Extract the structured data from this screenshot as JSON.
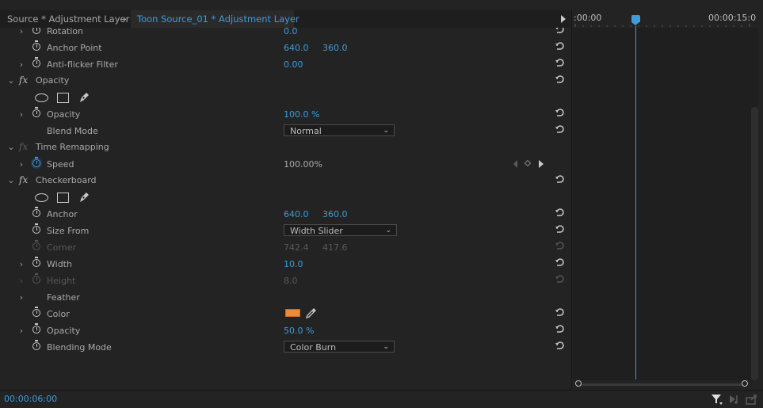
{
  "tabs": {
    "source": "Source * Adjustment Layer",
    "active": "Toon Source_01 * Adjustment Layer"
  },
  "timeline": {
    "ruler_start": ":00:00",
    "ruler_end": "00:00:15:0"
  },
  "rows": {
    "rotation": {
      "label": "Rotation",
      "v1": "0.0"
    },
    "anchor_point": {
      "label": "Anchor Point",
      "v1": "640.0",
      "v2": "360.0"
    },
    "anti_flicker": {
      "label": "Anti-flicker Filter",
      "v1": "0.00"
    },
    "opacity_section": {
      "label": "Opacity"
    },
    "opacity": {
      "label": "Opacity",
      "v1": "100.0 %"
    },
    "blend_mode": {
      "label": "Blend Mode",
      "value": "Normal"
    },
    "time_remapping": {
      "label": "Time Remapping"
    },
    "speed": {
      "label": "Speed",
      "v1": "100.00%"
    },
    "checkerboard": {
      "label": "Checkerboard"
    },
    "cb_anchor": {
      "label": "Anchor",
      "v1": "640.0",
      "v2": "360.0"
    },
    "size_from": {
      "label": "Size From",
      "value": "Width Slider"
    },
    "corner": {
      "label": "Corner",
      "v1": "742.4",
      "v2": "417.6"
    },
    "width": {
      "label": "Width",
      "v1": "10.0"
    },
    "height": {
      "label": "Height",
      "v1": "8.0"
    },
    "feather": {
      "label": "Feather"
    },
    "color": {
      "label": "Color",
      "swatch": "#ee8a3c"
    },
    "cb_opacity": {
      "label": "Opacity",
      "v1": "50.0 %"
    },
    "blending_mode": {
      "label": "Blending Mode",
      "value": "Color Burn"
    }
  },
  "status": {
    "timecode": "00:00:06:00"
  },
  "colors": {
    "accent": "#3f9bd9",
    "background": "#232323"
  }
}
